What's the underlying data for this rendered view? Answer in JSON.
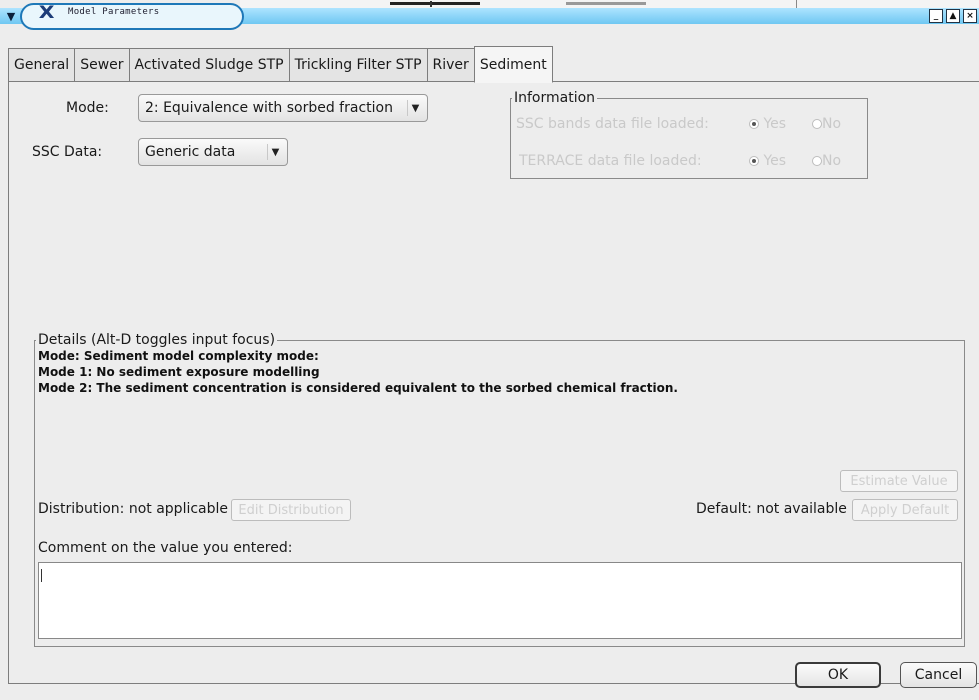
{
  "window": {
    "title": "Model Parameters",
    "menu_icon": "chevron-down-icon",
    "app_icon": "x-logo-icon",
    "controls": [
      "_",
      "▲",
      "×"
    ]
  },
  "tabs": [
    {
      "label": "General"
    },
    {
      "label": "Sewer"
    },
    {
      "label": "Activated Sludge STP"
    },
    {
      "label": "Trickling Filter STP"
    },
    {
      "label": "River"
    },
    {
      "label": "Sediment",
      "active": true
    }
  ],
  "form": {
    "mode_label": "Mode:",
    "mode_value": "2: Equivalence with sorbed fraction",
    "ssc_label": "SSC Data:",
    "ssc_value": "Generic data"
  },
  "information": {
    "title": "Information",
    "rows": [
      {
        "label": "SSC bands data file loaded:",
        "yes": "Yes",
        "no": "No",
        "selected": "Yes"
      },
      {
        "label": "TERRACE data file loaded:",
        "yes": "Yes",
        "no": "No",
        "selected": "Yes"
      }
    ]
  },
  "details": {
    "title": "Details (Alt-D toggles input focus)",
    "lines": [
      "Mode: Sediment model complexity mode:",
      "Mode 1: No sediment exposure modelling",
      "Mode 2: The sediment concentration is considered equivalent to the sorbed chemical fraction."
    ],
    "estimate_button": "Estimate Value",
    "distribution_text": "Distribution: not applicable",
    "edit_distribution_button": "Edit Distribution",
    "default_text": "Default: not available",
    "apply_default_button": "Apply Default",
    "comment_label": "Comment on the value you entered:",
    "comment_value": ""
  },
  "footer": {
    "ok_label": "OK",
    "cancel_label": "Cancel"
  }
}
